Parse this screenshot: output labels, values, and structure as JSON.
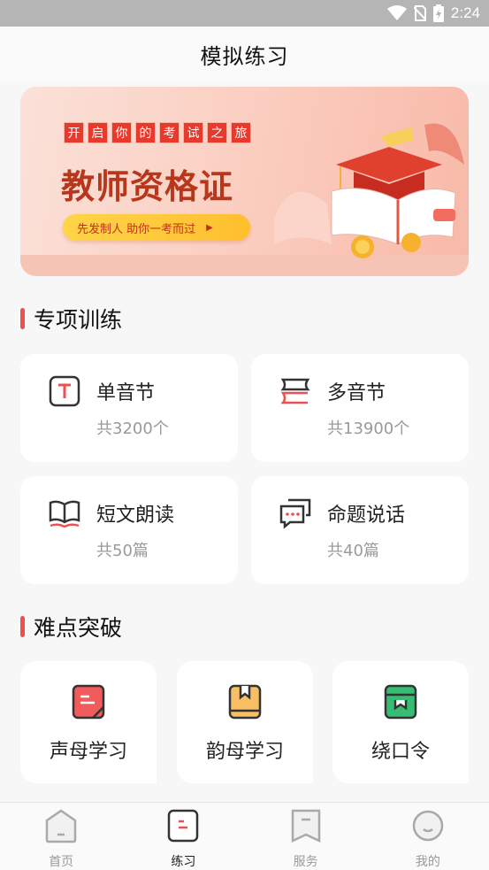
{
  "status_bar": {
    "time": "2:24"
  },
  "header": {
    "title": "模拟练习"
  },
  "banner": {
    "tagline": [
      "开",
      "启",
      "你",
      "的",
      "考",
      "试",
      "之",
      "旅"
    ],
    "headline": "教师资格证",
    "pill_text": "先发制人 助你一考而过",
    "pill_arrow": "▶"
  },
  "special_training": {
    "title": "专项训练",
    "cards": [
      {
        "label": "单音节",
        "count": "共3200个",
        "icon": "letter-t-icon"
      },
      {
        "label": "多音节",
        "count": "共13900个",
        "icon": "stacked-books-icon"
      },
      {
        "label": "短文朗读",
        "count": "共50篇",
        "icon": "open-book-icon"
      },
      {
        "label": "命题说话",
        "count": "共40篇",
        "icon": "chat-bubbles-icon"
      }
    ]
  },
  "difficulties": {
    "title": "难点突破",
    "tiles": [
      {
        "label": "声母学习",
        "icon": "red-notebook-icon",
        "color": "#f25b5b"
      },
      {
        "label": "韵母学习",
        "icon": "orange-book-icon",
        "color": "#f8bf64"
      },
      {
        "label": "绕口令",
        "icon": "green-book-icon",
        "color": "#37bd73"
      }
    ]
  },
  "tab_bar": {
    "tabs": [
      {
        "label": "首页",
        "icon": "home-icon",
        "active": false
      },
      {
        "label": "练习",
        "icon": "practice-icon",
        "active": true
      },
      {
        "label": "服务",
        "icon": "bookmark-icon",
        "active": false
      },
      {
        "label": "我的",
        "icon": "profile-icon",
        "active": false
      }
    ]
  },
  "colors": {
    "accent": "#ef4f4f",
    "banner_text": "#b8371c",
    "muted": "#9a9a9a"
  }
}
